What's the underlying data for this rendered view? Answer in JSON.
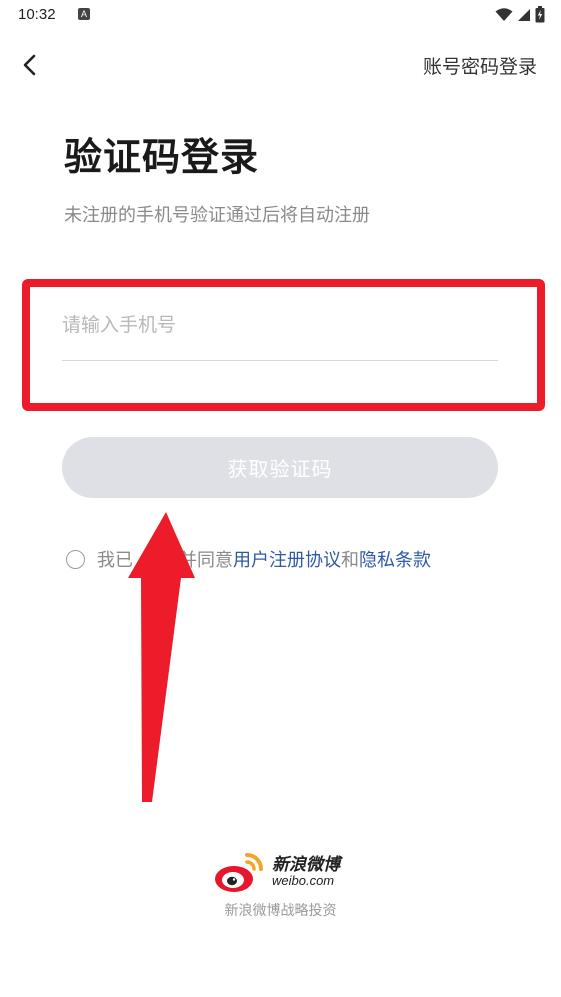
{
  "status_bar": {
    "time": "10:32",
    "notification_badge": "A"
  },
  "header": {
    "switch_login_label": "账号密码登录"
  },
  "main": {
    "title": "验证码登录",
    "subtitle": "未注册的手机号验证通过后将自动注册",
    "phone_placeholder": "请输入手机号",
    "phone_value": "",
    "get_code_label": "获取验证码",
    "agreement": {
      "prefix_visible": "我已",
      "middle_visible": "并同意",
      "link_terms": "用户注册协议",
      "conjunction": "和",
      "link_privacy": "隐私条款"
    }
  },
  "footer": {
    "brand_cn": "新浪微博",
    "brand_en": "weibo.com",
    "caption": "新浪微博战略投资"
  },
  "colors": {
    "highlight": "#ec1c2b",
    "link": "#2f59a8",
    "button_disabled": "#dfe0e5",
    "weibo_red": "#e6162d",
    "weibo_orange": "#f4a32b"
  },
  "icons": {
    "back": "chevron-left-icon",
    "wifi": "wifi-icon",
    "signal": "signal-icon",
    "battery": "battery-icon",
    "checkbox": "radio-unchecked-icon",
    "logo": "weibo-logo-icon"
  }
}
